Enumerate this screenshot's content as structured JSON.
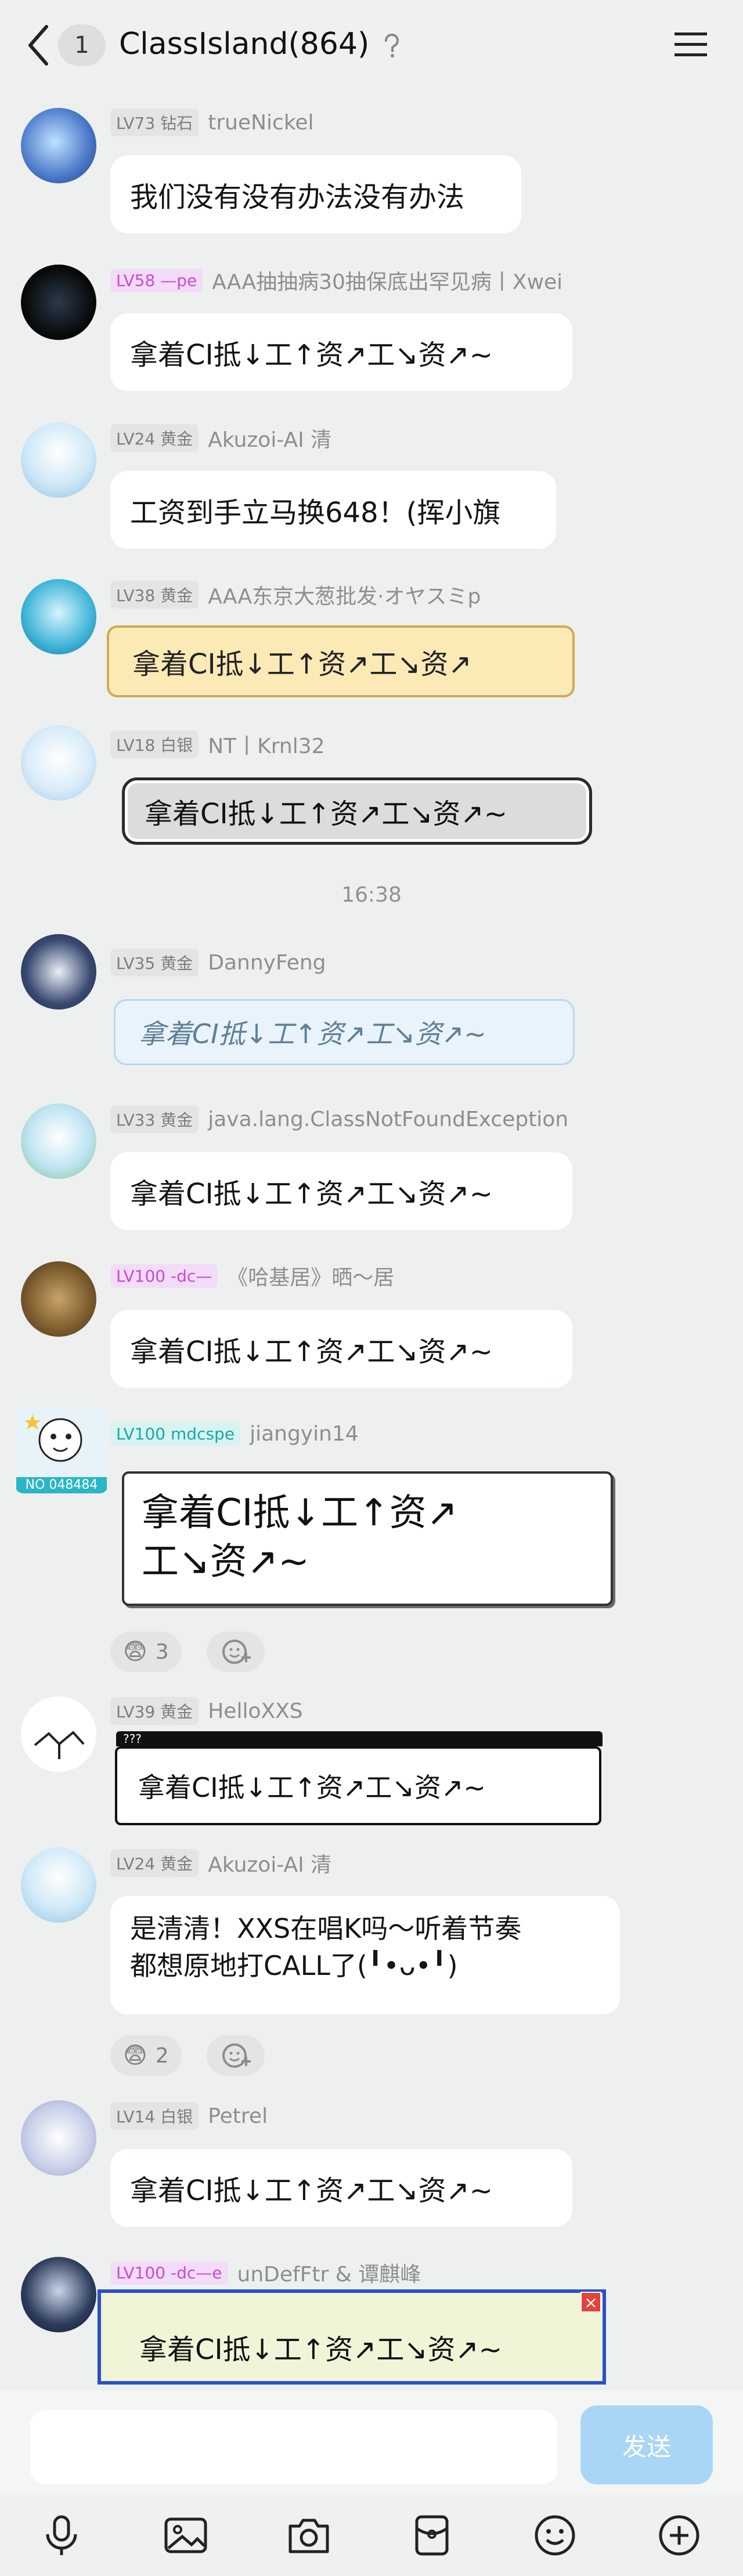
{
  "header": {
    "unread_count": "1",
    "title": "ClassIsland(864)"
  },
  "timestamp": "16:38",
  "messages": [
    {
      "level": "LV73 钻石",
      "nick": "trueNickel",
      "text": "我们没有没有办法没有办法"
    },
    {
      "level": "LV58 —pe",
      "nick": "AAA抽抽病30抽保底出罕见病丨Xwei",
      "text": "拿着CI抵↓工↑资↗工↘资↗~"
    },
    {
      "level": "LV24 黄金",
      "nick": "Akuzoi-AI 清",
      "text": "工资到手立马换648！(挥小旗"
    },
    {
      "level": "LV38 黄金",
      "nick": "AAA东京大葱批发·オヤスミp",
      "text": "拿着CI抵↓工↑资↗工↘资↗"
    },
    {
      "level": "LV18 白银",
      "nick": "NT丨Krnl32",
      "text": "拿着CI抵↓工↑资↗工↘资↗~"
    },
    {
      "level": "LV35 黄金",
      "nick": "DannyFeng",
      "text": "拿着CI抵↓工↑资↗工↘资↗~"
    },
    {
      "level": "LV33 黄金",
      "nick": "java.lang.ClassNotFoundException",
      "text": "拿着CI抵↓工↑资↗工↘资↗~"
    },
    {
      "level": "LV100 -dc—",
      "nick": "《哈基居》晒～居",
      "text": "拿着CI抵↓工↑资↗工↘资↗~"
    },
    {
      "level": "LV100 mdcspe",
      "nick": "jiangyin14",
      "text_line1": "拿着CI抵↓工↑资↗",
      "text_line2": "工↘资↗~",
      "avatar_caption": "NO 048484",
      "reaction_count": "3"
    },
    {
      "level": "LV39 黄金",
      "nick": "HelloXXS",
      "text": "拿着CI抵↓工↑资↗工↘资↗~",
      "window_title": "???"
    },
    {
      "level": "LV24 黄金",
      "nick": "Akuzoi-AI 清",
      "text_line1": "是清清！XXS在唱K吗～听着节奏",
      "text_line2": "都想原地打CALL了(╹•ᴗ•╹)",
      "reaction_count": "2"
    },
    {
      "level": "LV14 白银",
      "nick": "Petrel",
      "text": "拿着CI抵↓工↑资↗工↘资↗~"
    },
    {
      "level": "LV100 -dc—e",
      "nick": "unDefFtr & 谭麒峰",
      "text": "拿着CI抵↓工↑资↗工↘资↗~"
    }
  ],
  "composer": {
    "send_label": "发送"
  },
  "icons": {
    "back": "chevron-left-icon",
    "help": "question-mark-icon",
    "menu": "hamburger-menu-icon",
    "reaction_emoji": "fearful-face-emoji",
    "add_reaction": "add-reaction-icon",
    "toolbar": [
      "microphone-icon",
      "image-icon",
      "camera-icon",
      "red-packet-icon",
      "emoji-icon",
      "plus-icon"
    ]
  },
  "colors": {
    "background": "#edf0ef",
    "send_button": "#a9d6f7",
    "level_purple": "#c84ad6",
    "level_teal": "#19a9a3"
  }
}
